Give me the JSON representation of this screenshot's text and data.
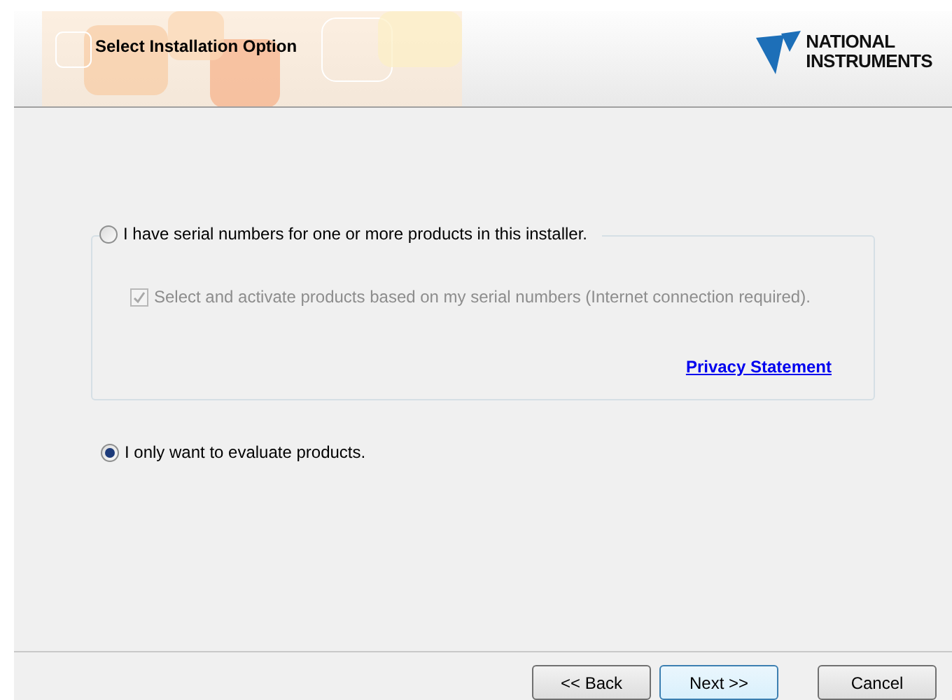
{
  "header": {
    "title": "Select Installation Option",
    "logo_lines": [
      "NATIONAL",
      "INSTRUMENTS"
    ]
  },
  "options": [
    {
      "label": "I have serial numbers for one or more products in this installer.",
      "selected": false,
      "checkbox": {
        "label": "Select and activate products based on my serial numbers (Internet connection required).",
        "checked": true,
        "disabled": true
      },
      "link": "Privacy Statement"
    },
    {
      "label": "I only want to evaluate products.",
      "selected": true
    }
  ],
  "buttons": [
    {
      "label": "<< Back",
      "default": false
    },
    {
      "label": "Next >>",
      "default": true
    },
    {
      "label": "Cancel",
      "default": false
    }
  ]
}
